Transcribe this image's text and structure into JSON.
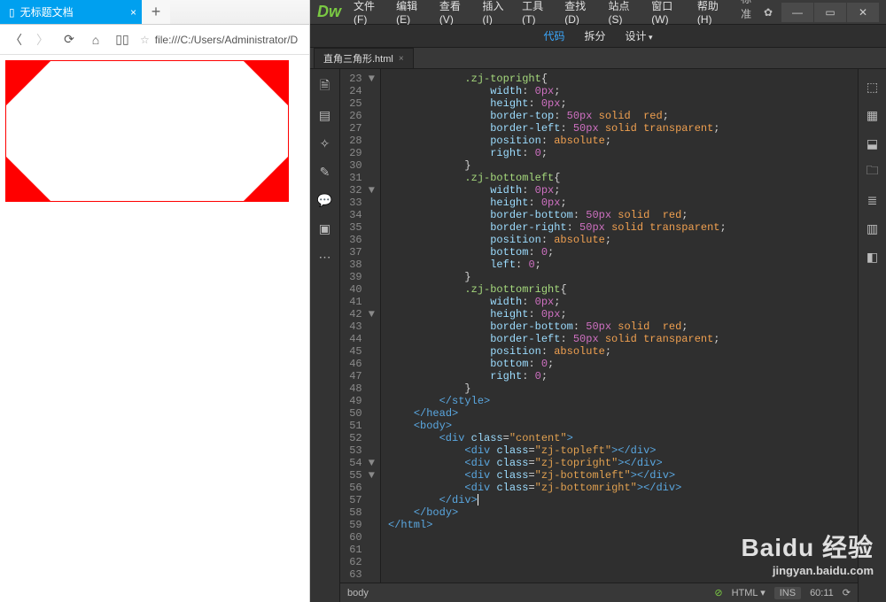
{
  "browser": {
    "tab_title": "无标题文档",
    "tab_close": "×",
    "newtab": "+",
    "address": "file:///C:/Users/Administrator/D"
  },
  "dw": {
    "logo": "Dw",
    "menu": [
      "文件(F)",
      "编辑(E)",
      "查看(V)",
      "插入(I)",
      "工具(T)",
      "查找(D)",
      "站点(S)",
      "窗口(W)",
      "帮助(H)"
    ],
    "layout_label": "标准",
    "gear": "✿",
    "win_min": "—",
    "win_max": "▭",
    "win_close": "✕",
    "viewbar": {
      "code": "代码",
      "split": "拆分",
      "design": "设计"
    },
    "filetab": {
      "name": "直角三角形.html",
      "close": "×"
    },
    "code_lines": [
      {
        "n": "23",
        "a": "▼",
        "html": "            <span class='sel'>.zj-topright</span><span class='brkt'>{</span>"
      },
      {
        "n": "24",
        "a": " ",
        "html": "                <span class='prop'>width</span>: <span class='num'>0px</span>;"
      },
      {
        "n": "25",
        "a": " ",
        "html": "                <span class='prop'>height</span>: <span class='num'>0px</span>;"
      },
      {
        "n": "26",
        "a": " ",
        "html": "                <span class='prop'>border-top</span>: <span class='num'>50px</span> <span class='kw'>solid</span>  <span class='kw'>red</span>;"
      },
      {
        "n": "27",
        "a": " ",
        "html": "                <span class='prop'>border-left</span>: <span class='num'>50px</span> <span class='kw'>solid</span> <span class='kw'>transparent</span>;"
      },
      {
        "n": "28",
        "a": " ",
        "html": "                <span class='prop'>position</span>: <span class='kw'>absolute</span>;"
      },
      {
        "n": "29",
        "a": " ",
        "html": "                <span class='prop'>right</span>: <span class='num'>0</span>;"
      },
      {
        "n": "30",
        "a": " ",
        "html": "            <span class='brkt'>}</span>"
      },
      {
        "n": "31",
        "a": " ",
        "html": ""
      },
      {
        "n": "32",
        "a": "▼",
        "html": "            <span class='sel'>.zj-bottomleft</span><span class='brkt'>{</span>"
      },
      {
        "n": "33",
        "a": " ",
        "html": "                <span class='prop'>width</span>: <span class='num'>0px</span>;"
      },
      {
        "n": "34",
        "a": " ",
        "html": "                <span class='prop'>height</span>: <span class='num'>0px</span>;"
      },
      {
        "n": "35",
        "a": " ",
        "html": "                <span class='prop'>border-bottom</span>: <span class='num'>50px</span> <span class='kw'>solid</span>  <span class='kw'>red</span>;"
      },
      {
        "n": "36",
        "a": " ",
        "html": "                <span class='prop'>border-right</span>: <span class='num'>50px</span> <span class='kw'>solid</span> <span class='kw'>transparent</span>;"
      },
      {
        "n": "37",
        "a": " ",
        "html": "                <span class='prop'>position</span>: <span class='kw'>absolute</span>;"
      },
      {
        "n": "38",
        "a": " ",
        "html": "                <span class='prop'>bottom</span>: <span class='num'>0</span>;"
      },
      {
        "n": "39",
        "a": " ",
        "html": "                <span class='prop'>left</span>: <span class='num'>0</span>;"
      },
      {
        "n": "40",
        "a": " ",
        "html": "            <span class='brkt'>}</span>"
      },
      {
        "n": "41",
        "a": " ",
        "html": ""
      },
      {
        "n": "42",
        "a": "▼",
        "html": "            <span class='sel'>.zj-bottomright</span><span class='brkt'>{</span>"
      },
      {
        "n": "43",
        "a": " ",
        "html": "                <span class='prop'>width</span>: <span class='num'>0px</span>;"
      },
      {
        "n": "44",
        "a": " ",
        "html": "                <span class='prop'>height</span>: <span class='num'>0px</span>;"
      },
      {
        "n": "45",
        "a": " ",
        "html": "                <span class='prop'>border-bottom</span>: <span class='num'>50px</span> <span class='kw'>solid</span>  <span class='kw'>red</span>;"
      },
      {
        "n": "46",
        "a": " ",
        "html": "                <span class='prop'>border-left</span>: <span class='num'>50px</span> <span class='kw'>solid</span> <span class='kw'>transparent</span>;"
      },
      {
        "n": "47",
        "a": " ",
        "html": "                <span class='prop'>position</span>: <span class='kw'>absolute</span>;"
      },
      {
        "n": "48",
        "a": " ",
        "html": "                <span class='prop'>bottom</span>: <span class='num'>0</span>;"
      },
      {
        "n": "49",
        "a": " ",
        "html": "                <span class='prop'>right</span>: <span class='num'>0</span>;"
      },
      {
        "n": "50",
        "a": " ",
        "html": "            <span class='brkt'>}</span>"
      },
      {
        "n": "51",
        "a": " ",
        "html": "        <span class='tag'>&lt;/style&gt;</span>"
      },
      {
        "n": "52",
        "a": " ",
        "html": "    <span class='tag'>&lt;/head&gt;</span>"
      },
      {
        "n": "53",
        "a": " ",
        "html": ""
      },
      {
        "n": "54",
        "a": "▼",
        "html": "    <span class='tag'>&lt;body&gt;</span>"
      },
      {
        "n": "55",
        "a": "▼",
        "html": "        <span class='tag'>&lt;div</span> <span class='attr'>class</span>=<span class='str'>\"content\"</span><span class='tag'>&gt;</span>"
      },
      {
        "n": "56",
        "a": " ",
        "html": "            <span class='tag'>&lt;div</span> <span class='attr'>class</span>=<span class='str'>\"zj-topleft\"</span><span class='tag'>&gt;&lt;/div&gt;</span>"
      },
      {
        "n": "57",
        "a": " ",
        "html": "            <span class='tag'>&lt;div</span> <span class='attr'>class</span>=<span class='str'>\"zj-topright\"</span><span class='tag'>&gt;&lt;/div&gt;</span>"
      },
      {
        "n": "58",
        "a": " ",
        "html": "            <span class='tag'>&lt;div</span> <span class='attr'>class</span>=<span class='str'>\"zj-bottomleft\"</span><span class='tag'>&gt;&lt;/div&gt;</span>"
      },
      {
        "n": "59",
        "a": " ",
        "html": "            <span class='tag'>&lt;div</span> <span class='attr'>class</span>=<span class='str'>\"zj-bottomright\"</span><span class='tag'>&gt;&lt;/div&gt;</span>"
      },
      {
        "n": "60",
        "a": " ",
        "html": "        <span class='tag'>&lt;/div&gt;</span><span class='cursor'></span>"
      },
      {
        "n": "61",
        "a": " ",
        "html": "    <span class='tag'>&lt;/body&gt;</span>"
      },
      {
        "n": "62",
        "a": " ",
        "html": "<span class='tag'>&lt;/html&gt;</span>"
      },
      {
        "n": "63",
        "a": " ",
        "html": ""
      }
    ],
    "status": {
      "path": "body",
      "ok": "⊘",
      "lang": "HTML",
      "lang_arrow": "▾",
      "ins": "INS",
      "pos": "60:11",
      "sync": "⟳"
    },
    "watermark_big": "Baidu 经验",
    "watermark_small": "jingyan.baidu.com"
  }
}
